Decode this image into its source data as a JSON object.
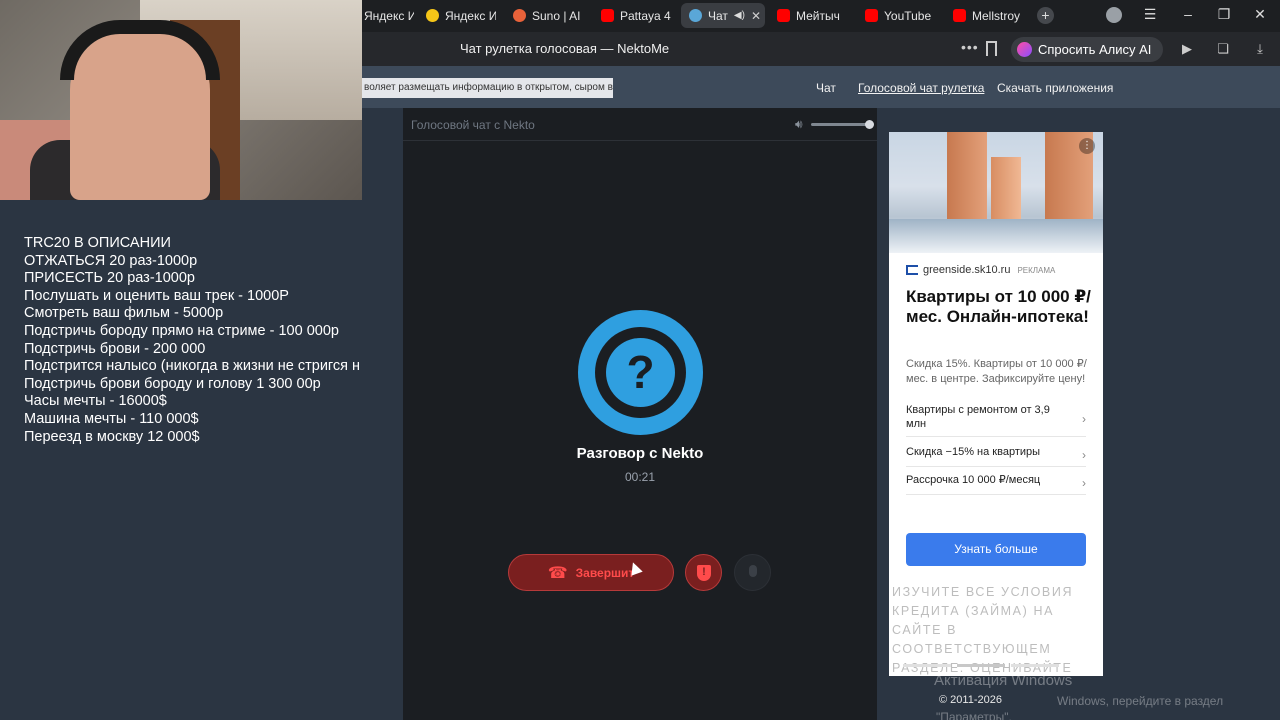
{
  "browser": {
    "tabs": [
      {
        "label": "Яндекс И",
        "icon": "yandex-images-icon",
        "active": false
      },
      {
        "label": "Яндекс И",
        "icon": "yandex-images-icon",
        "active": false
      },
      {
        "label": "Suno | AI",
        "icon": "suno-icon",
        "active": false
      },
      {
        "label": "Pattaya 4",
        "icon": "youtube-icon",
        "active": false
      },
      {
        "label": "Чат",
        "icon": "nekto-icon",
        "active": true
      },
      {
        "label": "Мейтыч",
        "icon": "youtube-icon",
        "active": false
      },
      {
        "label": "YouTube",
        "icon": "youtube-icon",
        "active": false
      },
      {
        "label": "Mellstroy",
        "icon": "youtube-icon",
        "active": false
      }
    ],
    "page_title": "Чат рулетка голосовая — NektoMe",
    "alice_button": "Спросить Алису AI"
  },
  "site": {
    "notice": "воляет размещать информацию в открытом, сыром виде!",
    "nav": {
      "chat": "Чат",
      "voice_roulette": "Голосовой чат рулетка",
      "download": "Скачать приложения"
    },
    "panel_title": "Голосовой чат с Nekto",
    "call": {
      "avatar_glyph": "?",
      "title": "Разговор с Nekto",
      "timer": "00:21",
      "end_label": "Завершит"
    },
    "copyright": "© 2011-2026"
  },
  "ad": {
    "domain": "greenside.sk10.ru",
    "tag": "РЕКЛАМА",
    "headline": "Квартиры от 10 000 ₽/мес. Онлайн-ипотека!",
    "body": "Скидка 15%. Квартиры от 10 000 ₽/мес. в центре. Зафиксируйте цену!",
    "items": [
      "Квартиры с ремонтом от 3,9 млн",
      "Скидка −15% на квартиры",
      "Рассрочка 10 000 ₽/месяц"
    ],
    "cta": "Узнать больше",
    "disclaimer": "Изучите все условия кредита (займа) на сайте в соответствующем разделе. Оценивайте свои финансовые возможности и риски"
  },
  "windows": {
    "activation_title": "Активация Windows",
    "activation_sub": "Windows, перейдите в раздел",
    "activation_sub2": "\"Параметры\"."
  },
  "overlay": {
    "lines": [
      "TRC20 В ОПИСАНИИ",
      "ОТЖАТЬСЯ 20 раз-1000р",
      "ПРИСЕСТЬ 20 раз-1000р",
      "Послушать и оценить ваш трек - 1000Р",
      "Смотреть ваш фильм - 5000р",
      "Подстричь бороду прямо на стриме - 100 000р",
      "Подстричь брови - 200 000",
      "Подстрится налысо (никогда в жизни не стригся н",
      "Подстричь брови бороду и голову 1 300 00р",
      "Часы мечты - 16000$",
      "Машина мечты - 110 000$",
      "Переезд в москву 12 000$"
    ]
  },
  "colors": {
    "accent": "#2f9fe0",
    "danger": "#ff4b4b",
    "cta": "#3a7bec"
  }
}
